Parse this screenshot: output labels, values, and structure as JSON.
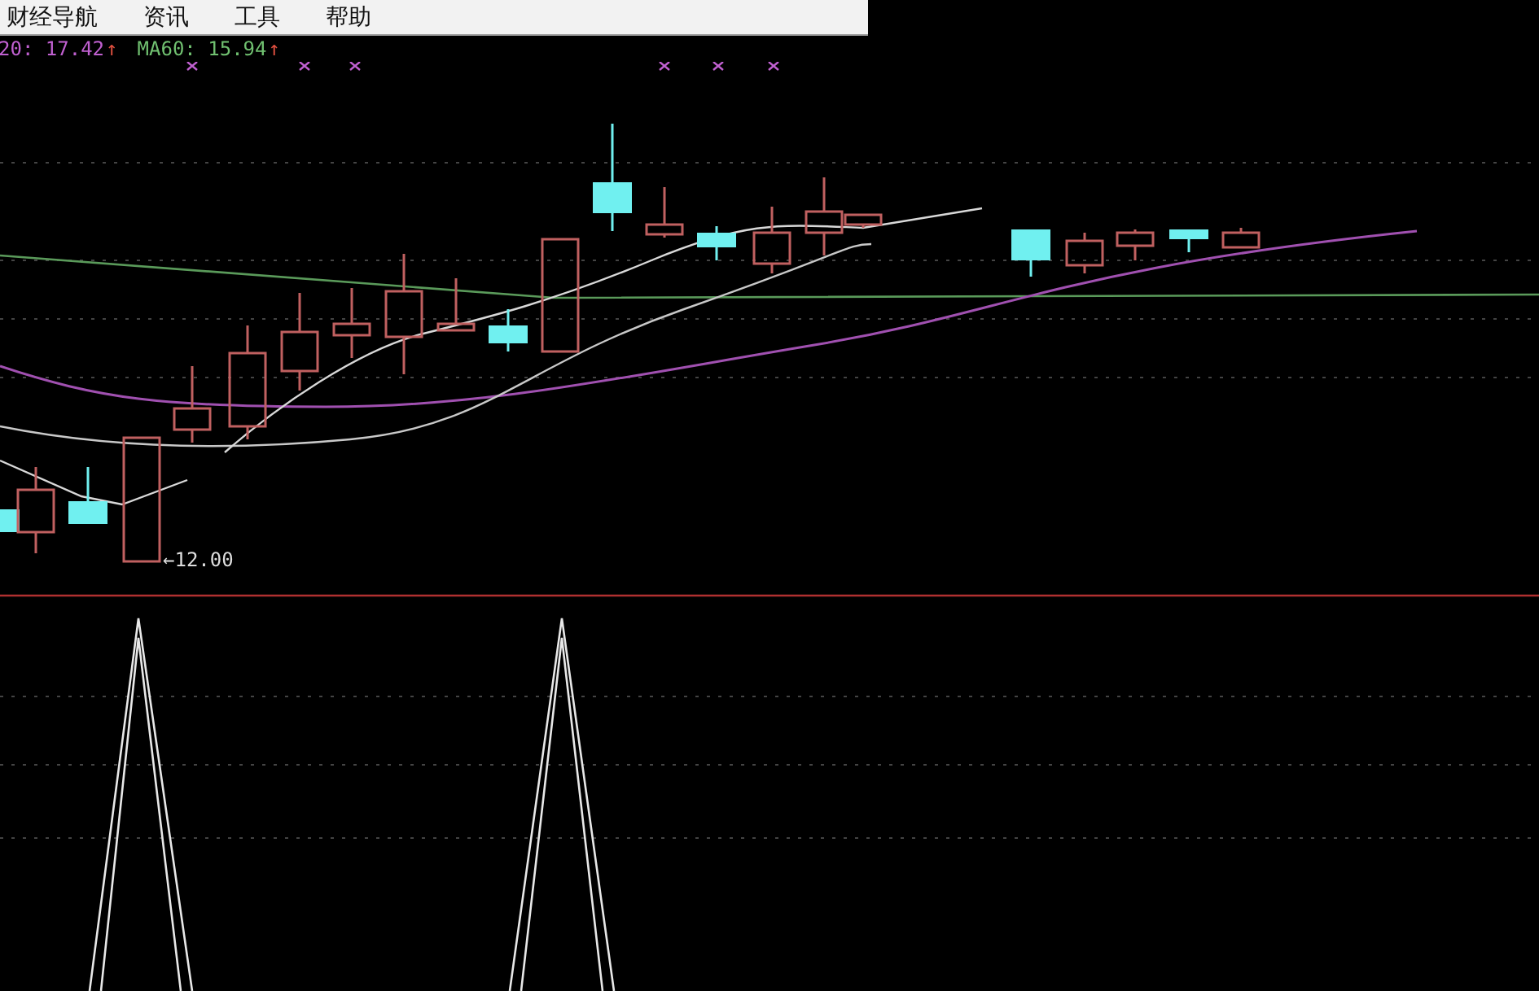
{
  "menu_bar": {
    "items": [
      "财经导航",
      "资讯",
      "工具",
      "帮助"
    ]
  },
  "ma_legend": [
    {
      "text": "20: 17.42",
      "arrow": "↑",
      "color": "#c060d0"
    },
    {
      "text": "MA60: 15.94",
      "arrow": "↑",
      "color": "#70c070"
    }
  ],
  "chart": {
    "low_marker": "←12.00"
  }
}
